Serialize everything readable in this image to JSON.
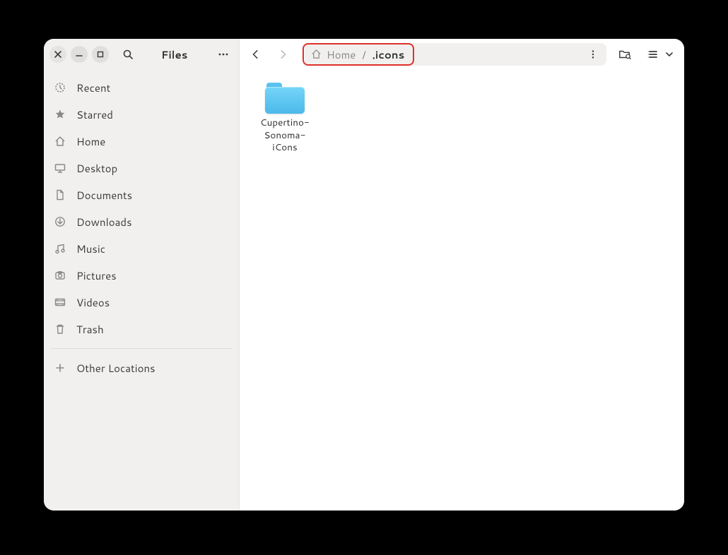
{
  "app_title": "Files",
  "breadcrumb": {
    "parent": "Home",
    "separator": "/",
    "current": ".icons"
  },
  "sidebar": {
    "items": [
      {
        "label": "Recent",
        "icon": "recent-icon"
      },
      {
        "label": "Starred",
        "icon": "star-icon"
      },
      {
        "label": "Home",
        "icon": "home-icon"
      },
      {
        "label": "Desktop",
        "icon": "desktop-icon"
      },
      {
        "label": "Documents",
        "icon": "documents-icon"
      },
      {
        "label": "Downloads",
        "icon": "downloads-icon"
      },
      {
        "label": "Music",
        "icon": "music-icon"
      },
      {
        "label": "Pictures",
        "icon": "pictures-icon"
      },
      {
        "label": "Videos",
        "icon": "videos-icon"
      },
      {
        "label": "Trash",
        "icon": "trash-icon"
      }
    ],
    "other_locations": "Other Locations"
  },
  "files": [
    {
      "name": "Cupertino-Sonoma-iCons"
    }
  ]
}
